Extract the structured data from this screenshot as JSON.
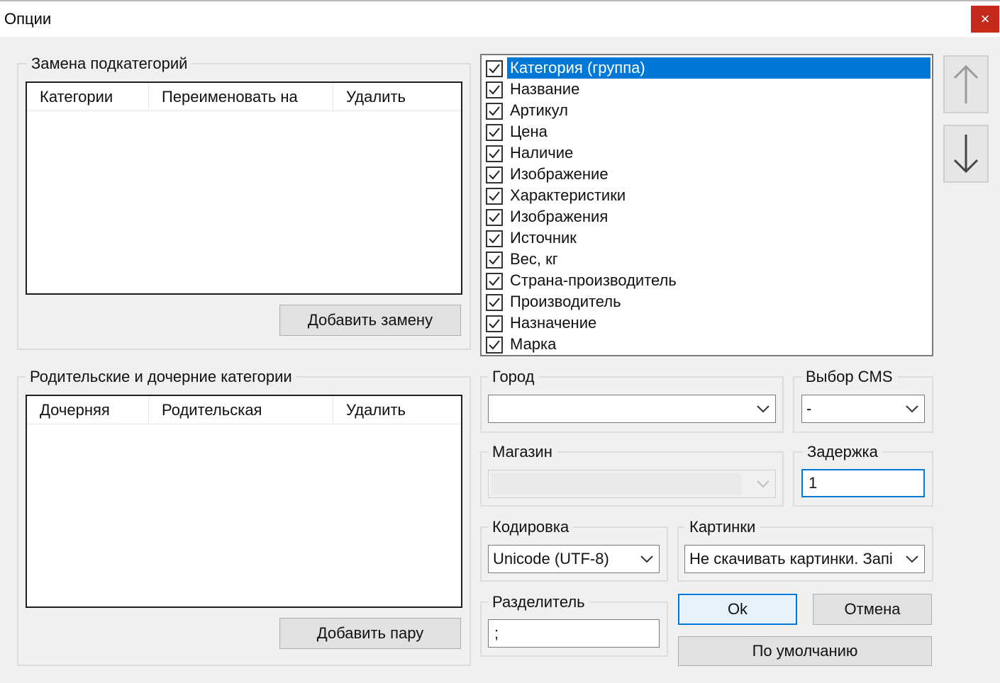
{
  "window": {
    "title": "Опции",
    "close_label": "×"
  },
  "replace_group": {
    "title": "Замена подкатегорий",
    "columns": [
      "Категории",
      "Переименовать на",
      "Удалить"
    ],
    "add_button": "Добавить замену"
  },
  "parent_group": {
    "title": "Родительские и дочерние категории",
    "columns": [
      "Дочерняя",
      "Родительская",
      "Удалить"
    ],
    "add_button": "Добавить пару"
  },
  "fields_list": {
    "items": [
      {
        "label": "Категория (группа)",
        "checked": true,
        "selected": true
      },
      {
        "label": "Название",
        "checked": true
      },
      {
        "label": "Артикул",
        "checked": true
      },
      {
        "label": "Цена",
        "checked": true
      },
      {
        "label": "Наличие",
        "checked": true
      },
      {
        "label": "Изображение",
        "checked": true
      },
      {
        "label": "Характеристики",
        "checked": true
      },
      {
        "label": "Изображения",
        "checked": true
      },
      {
        "label": "Источник",
        "checked": true
      },
      {
        "label": "Вес, кг",
        "checked": true
      },
      {
        "label": "Страна-производитель",
        "checked": true
      },
      {
        "label": "Производитель",
        "checked": true
      },
      {
        "label": "Назначение",
        "checked": true
      },
      {
        "label": "Марка",
        "checked": true
      }
    ],
    "move_up_icon": "arrow-up-icon",
    "move_down_icon": "arrow-down-icon"
  },
  "city": {
    "label": "Город",
    "value": ""
  },
  "cms": {
    "label": "Выбор CMS",
    "value": "-"
  },
  "shop": {
    "label": "Магазин",
    "value": ""
  },
  "delay": {
    "label": "Задержка",
    "value": "1"
  },
  "encoding": {
    "label": "Кодировка",
    "value": "Unicode (UTF-8)"
  },
  "images": {
    "label": "Картинки",
    "value": "Не скачивать картинки. Запі"
  },
  "separator": {
    "label": "Разделитель",
    "value": ";"
  },
  "buttons": {
    "ok": "Ok",
    "cancel": "Отмена",
    "default": "По умолчанию"
  },
  "colors": {
    "selection": "#0078d7",
    "close": "#c42b1c",
    "background": "#f0f0f0"
  }
}
